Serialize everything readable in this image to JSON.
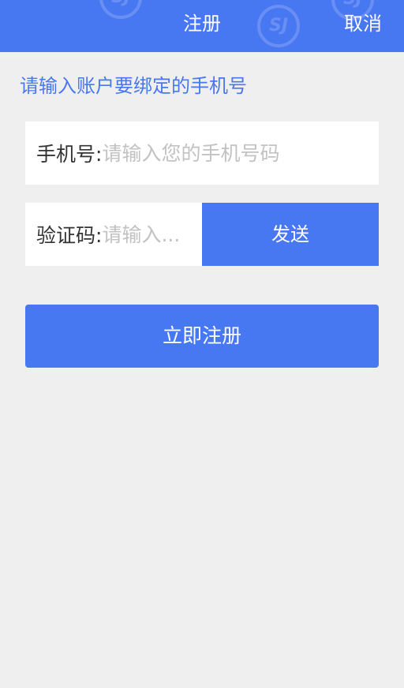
{
  "header": {
    "title": "注册",
    "cancel_label": "取消",
    "watermark_text": "SJ"
  },
  "hint": "请输入账户要绑定的手机号",
  "phone": {
    "label": "手机号:",
    "placeholder": "请输入您的手机号码",
    "value": ""
  },
  "code": {
    "label": "验证码:",
    "placeholder": "请输入...",
    "value": "",
    "send_label": "发送"
  },
  "register_label": "立即注册",
  "colors": {
    "primary": "#4877f2",
    "background": "#efefef",
    "placeholder": "#c2c2c2"
  }
}
